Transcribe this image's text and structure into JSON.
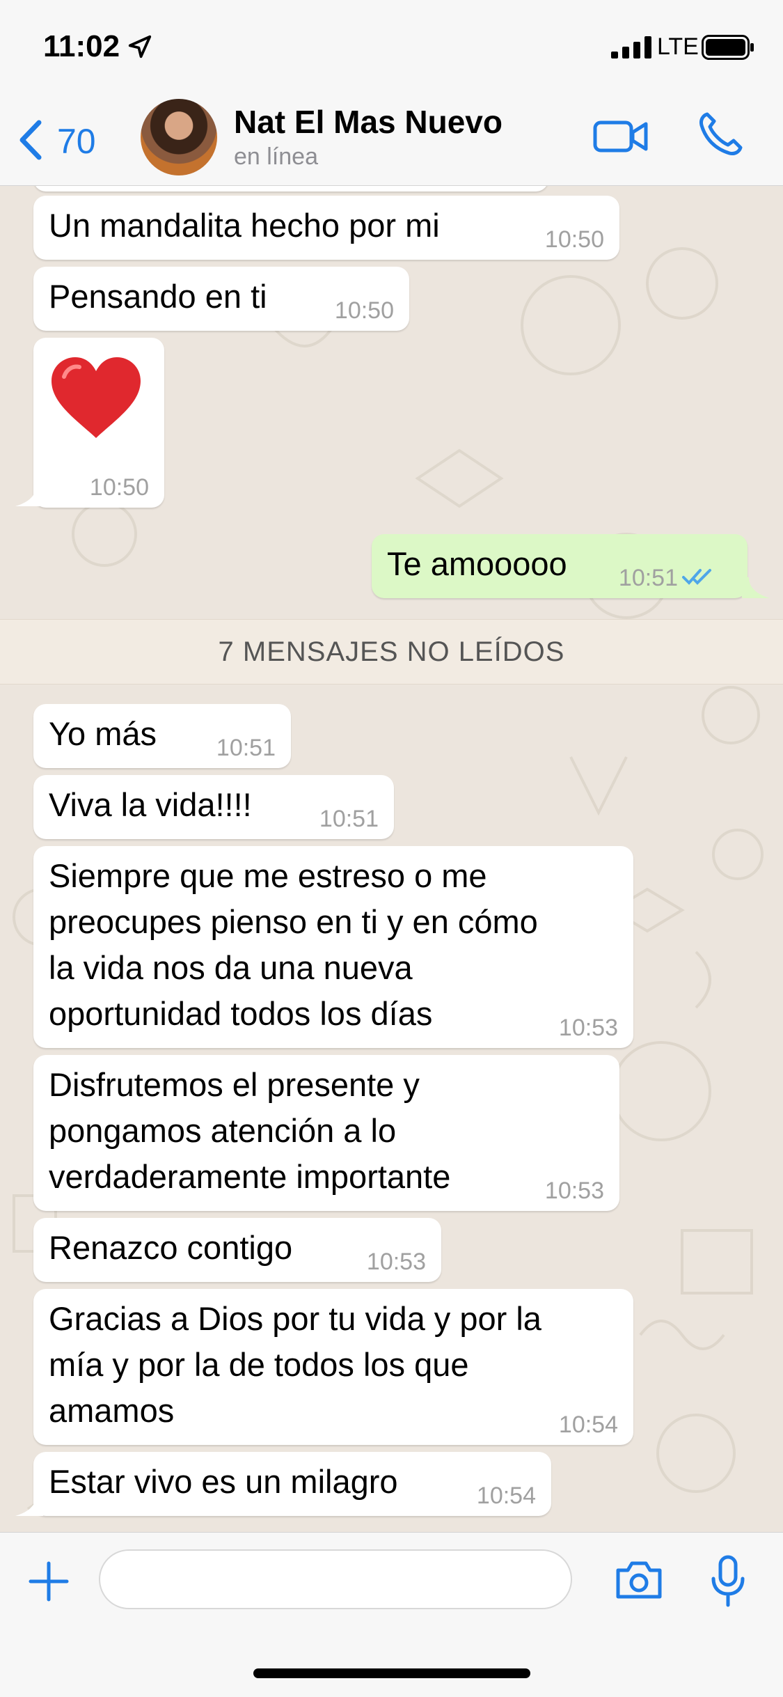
{
  "status_bar": {
    "time": "11:02",
    "network": "LTE"
  },
  "header": {
    "back_count": "70",
    "contact_name": "Nat El Mas Nuevo",
    "contact_status": "en línea"
  },
  "messages": [
    {
      "direction": "in",
      "text": "Un mandalita hecho por mi",
      "time": "10:50"
    },
    {
      "direction": "in",
      "text": "Pensando en ti",
      "time": "10:50"
    },
    {
      "direction": "in",
      "text": "❤️",
      "time": "10:50",
      "emoji_only": true
    },
    {
      "direction": "out",
      "text": "Te amooooo",
      "time": "10:51",
      "status": "read"
    },
    {
      "direction": "in",
      "text": "Yo más",
      "time": "10:51"
    },
    {
      "direction": "in",
      "text": "Viva la vida!!!!",
      "time": "10:51"
    },
    {
      "direction": "in",
      "lines": [
        "Siempre que me estreso o me",
        "preocupes pienso en ti y en cómo",
        "la vida nos da una nueva",
        "oportunidad todos los días"
      ],
      "time": "10:53"
    },
    {
      "direction": "in",
      "lines": [
        "Disfrutemos el presente y",
        "pongamos atención a lo",
        "verdaderamente importante"
      ],
      "time": "10:53"
    },
    {
      "direction": "in",
      "text": "Renazco contigo",
      "time": "10:53"
    },
    {
      "direction": "in",
      "lines": [
        "Gracias a Dios por tu vida y por la",
        "mía y por la de todos los que",
        "amamos"
      ],
      "time": "10:54"
    },
    {
      "direction": "in",
      "text": "Estar vivo es un milagro",
      "time": "10:54"
    }
  ],
  "unread_divider": "7 MENSAJES NO LEÍDOS",
  "composer": {
    "placeholder": ""
  },
  "colors": {
    "accent": "#1f7ce6",
    "outgoing_bubble": "#dcf8c6",
    "incoming_bubble": "#ffffff",
    "read_ticks": "#4fa6e8",
    "chat_background": "#ece5dd"
  },
  "icons": [
    "location-arrow-icon",
    "signal-icon",
    "battery-icon",
    "back-chevron-icon",
    "video-call-icon",
    "phone-icon",
    "plus-icon",
    "camera-icon",
    "microphone-icon",
    "read-ticks-icon"
  ]
}
